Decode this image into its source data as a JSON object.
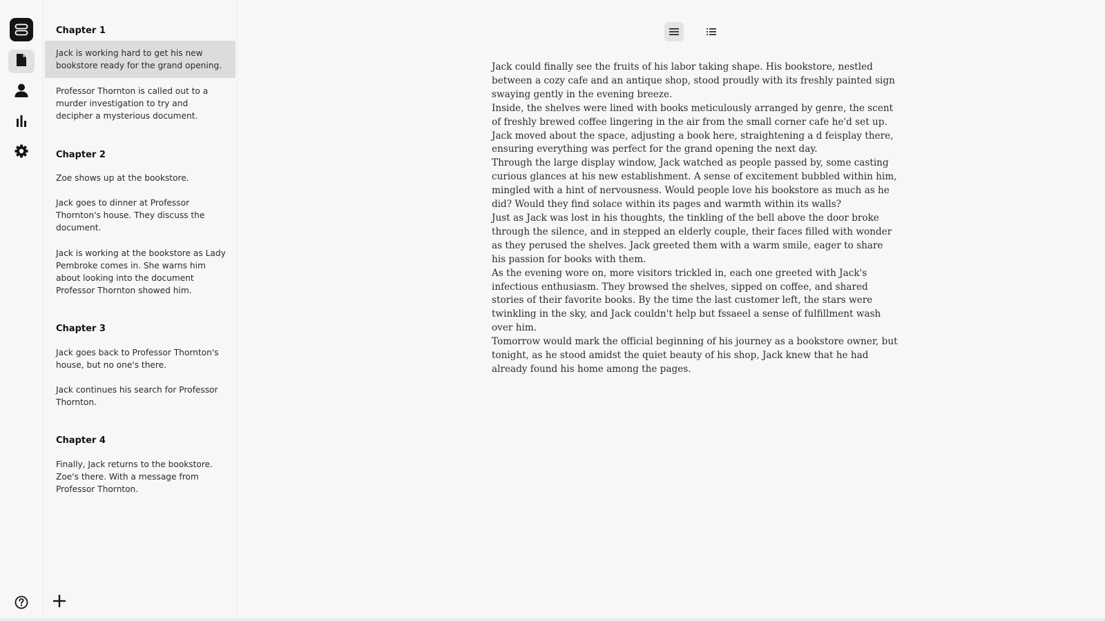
{
  "sidebar_nav": {
    "items": [
      {
        "icon": "document-icon",
        "active": true
      },
      {
        "icon": "user-icon",
        "active": false
      },
      {
        "icon": "bar-chart-icon",
        "active": false
      },
      {
        "icon": "gear-icon",
        "active": false
      }
    ],
    "help_icon": "help-icon"
  },
  "outline": {
    "chapters": [
      {
        "title": "Chapter 1",
        "scenes": [
          "Jack is working hard to get his new bookstore ready for the grand opening.",
          "Professor Thornton is called out to a murder investigation to try and decipher a mysterious document."
        ]
      },
      {
        "title": "Chapter 2",
        "scenes": [
          "Zoe shows up at the bookstore.",
          "Jack goes to dinner at Professor Thornton's house. They discuss the document.",
          "Jack is working at the bookstore as Lady Pembroke comes in. She warns him about looking into the document Professor Thornton showed him."
        ]
      },
      {
        "title": "Chapter 3",
        "scenes": [
          "Jack goes back to Professor Thornton's house, but no one's there.",
          "Jack continues his search for Professor Thornton."
        ]
      },
      {
        "title": "Chapter 4",
        "scenes": [
          "Finally, Jack returns to the bookstore. Zoe's there. With a message from Professor Thornton."
        ]
      }
    ],
    "add_icon": "plus-icon"
  },
  "view_toggles": [
    {
      "icon": "text-view-icon",
      "active": true
    },
    {
      "icon": "list-view-icon",
      "active": false
    }
  ],
  "editor": {
    "paragraphs": [
      "Jack could finally see the fruits of his labor taking shape. His bookstore, nestled between a cozy cafe and an antique shop, stood proudly with its freshly painted sign swaying gently in the evening breeze.",
      "Inside, the shelves were lined with books meticulously arranged by genre, the scent of freshly brewed coffee lingering in the air from the small corner cafe he'd set up. Jack moved about the space, adjusting a book here, straightening a d  feisplay there, ensuring everything was perfect for the grand opening the next day.",
      "Through the large display window, Jack watched as people passed by, some casting curious glances at his new establishment. A sense of excitement bubbled within him, mingled with a hint of nervousness. Would people love his bookstore as much as he did? Would they find solace within its pages and warmth within its walls?",
      "Just as Jack was lost in his thoughts, the tinkling of the bell above the door broke through the silence, and in stepped an elderly couple, their faces filled with wonder as they perused the shelves. Jack greeted them with a warm smile, eager to share his passion for books with them.",
      "As the evening wore on, more visitors trickled in, each one greeted with Jack's infectious enthusiasm. They browsed the shelves, sipped on coffee, and shared stories of their favorite books. By the time the last customer left, the stars were twinkling in the sky, and Jack couldn't help but fssaeel a sense of fulfillment wash over him.",
      "Tomorrow would mark the official beginning of his journey as a bookstore owner, but tonight, as he stood amidst the quiet beauty of his shop, Jack knew that he had already found his home among the pages."
    ]
  },
  "colors": {
    "background": "#f7f7f7",
    "selected": "#dcdcdc",
    "dark": "#151515"
  }
}
